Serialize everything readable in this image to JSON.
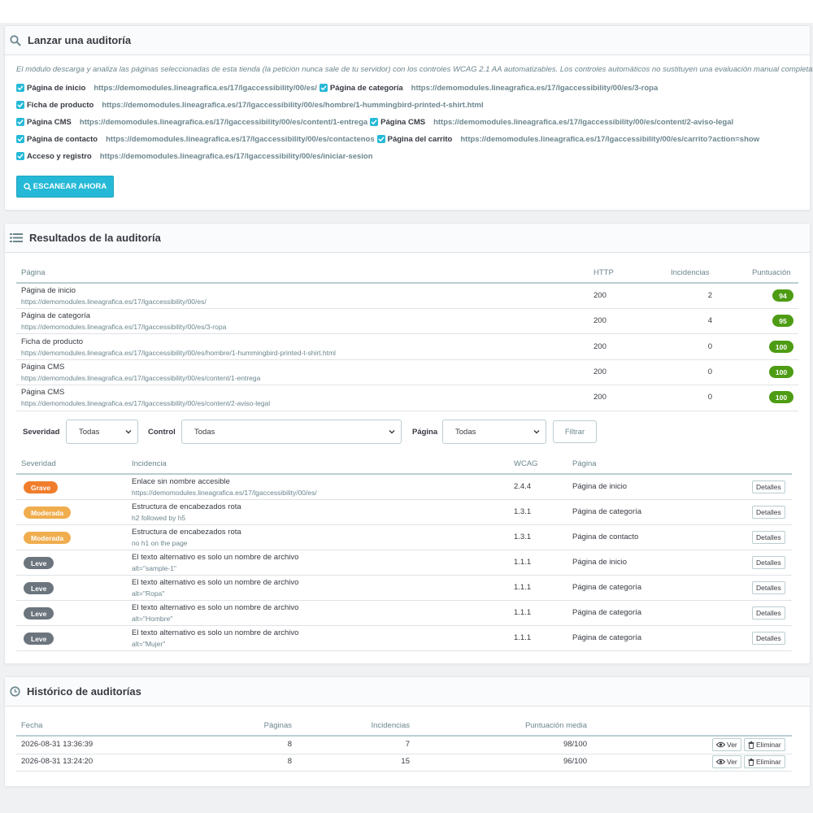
{
  "launch": {
    "title": "Lanzar una auditoría",
    "intro": "El módulo descarga y analiza las páginas seleccionadas de esta tienda (la petición nunca sale de tu servidor) con los controles WCAG 2.1 AA automatizables. Los controles automáticos no sustituyen una evaluación manual completa.",
    "pages": [
      {
        "label": "Página de inicio",
        "url": "https://demomodules.lineagrafica.es/17/lgaccessibility/00/es/",
        "checked": true
      },
      {
        "label": "Página de categoría",
        "url": "https://demomodules.lineagrafica.es/17/lgaccessibility/00/es/3-ropa",
        "checked": true
      },
      {
        "label": "Ficha de producto",
        "url": "https://demomodules.lineagrafica.es/17/lgaccessibility/00/es/hombre/1-hummingbird-printed-t-shirt.html",
        "checked": true
      },
      {
        "label": "Página CMS",
        "url": "https://demomodules.lineagrafica.es/17/lgaccessibility/00/es/content/1-entrega",
        "checked": true
      },
      {
        "label": "Página CMS",
        "url": "https://demomodules.lineagrafica.es/17/lgaccessibility/00/es/content/2-aviso-legal",
        "checked": true
      },
      {
        "label": "Página de contacto",
        "url": "https://demomodules.lineagrafica.es/17/lgaccessibility/00/es/contactenos",
        "checked": true
      },
      {
        "label": "Página del carrito",
        "url": "https://demomodules.lineagrafica.es/17/lgaccessibility/00/es/carrito?action=show",
        "checked": true
      },
      {
        "label": "Acceso y registro",
        "url": "https://demomodules.lineagrafica.es/17/lgaccessibility/00/es/iniciar-sesion",
        "checked": true
      }
    ],
    "scan_label": "ESCANEAR AHORA"
  },
  "results": {
    "title": "Resultados de la auditoría",
    "headers": {
      "page": "Página",
      "http": "HTTP",
      "issues": "Incidencias",
      "score": "Puntuación"
    },
    "rows": [
      {
        "page": "Página de inicio",
        "url": "https://demomodules.lineagrafica.es/17/lgaccessibility/00/es/",
        "http": "200",
        "issues": "2",
        "score": "94"
      },
      {
        "page": "Página de categoría",
        "url": "https://demomodules.lineagrafica.es/17/lgaccessibility/00/es/3-ropa",
        "http": "200",
        "issues": "4",
        "score": "95"
      },
      {
        "page": "Ficha de producto",
        "url": "https://demomodules.lineagrafica.es/17/lgaccessibility/00/es/hombre/1-hummingbird-printed-t-shirt.html",
        "http": "200",
        "issues": "0",
        "score": "100"
      },
      {
        "page": "Página CMS",
        "url": "https://demomodules.lineagrafica.es/17/lgaccessibility/00/es/content/1-entrega",
        "http": "200",
        "issues": "0",
        "score": "100"
      },
      {
        "page": "Página CMS",
        "url": "https://demomodules.lineagrafica.es/17/lgaccessibility/00/es/content/2-aviso-legal",
        "http": "200",
        "issues": "0",
        "score": "100"
      }
    ],
    "filters": {
      "severity_label": "Severidad",
      "severity_value": "Todas",
      "control_label": "Control",
      "control_value": "Todas",
      "page_label": "Página",
      "page_value": "Todas",
      "filter_button": "Filtrar"
    },
    "issue_headers": {
      "severity": "Severidad",
      "issue": "Incidencia",
      "wcag": "WCAG",
      "page": "Página"
    },
    "issues": [
      {
        "severity": "Grave",
        "level": "grave",
        "title": "Enlace sin nombre accesible",
        "detail": "https://demomodules.lineagrafica.es/17/lgaccessibility/00/es/",
        "wcag": "2.4.4",
        "page": "Página de inicio",
        "button": "Detalles"
      },
      {
        "severity": "Moderada",
        "level": "moderada",
        "title": "Estructura de encabezados rota",
        "detail": "h2 followed by h5",
        "wcag": "1.3.1",
        "page": "Página de categoría",
        "button": "Detalles"
      },
      {
        "severity": "Moderada",
        "level": "moderada",
        "title": "Estructura de encabezados rota",
        "detail": "no h1 on the page",
        "wcag": "1.3.1",
        "page": "Página de contacto",
        "button": "Detalles"
      },
      {
        "severity": "Leve",
        "level": "leve",
        "title": "El texto alternativo es solo un nombre de archivo",
        "detail": "alt=\"sample-1\"",
        "wcag": "1.1.1",
        "page": "Página de inicio",
        "button": "Detalles"
      },
      {
        "severity": "Leve",
        "level": "leve",
        "title": "El texto alternativo es solo un nombre de archivo",
        "detail": "alt=\"Ropa\"",
        "wcag": "1.1.1",
        "page": "Página de categoría",
        "button": "Detalles"
      },
      {
        "severity": "Leve",
        "level": "leve",
        "title": "El texto alternativo es solo un nombre de archivo",
        "detail": "alt=\"Hombre\"",
        "wcag": "1.1.1",
        "page": "Página de categoría",
        "button": "Detalles"
      },
      {
        "severity": "Leve",
        "level": "leve",
        "title": "El texto alternativo es solo un nombre de archivo",
        "detail": "alt=\"Mujer\"",
        "wcag": "1.1.1",
        "page": "Página de categoría",
        "button": "Detalles"
      }
    ]
  },
  "history": {
    "title": "Histórico de auditorías",
    "headers": {
      "date": "Fecha",
      "pages": "Páginas",
      "issues": "Incidencias",
      "avg": "Puntuación media"
    },
    "rows": [
      {
        "date": "2026-08-31 13:36:39",
        "pages": "8",
        "issues": "7",
        "avg": "98/100",
        "view": "Ver",
        "delete": "Eliminar"
      },
      {
        "date": "2026-08-31 13:24:20",
        "pages": "8",
        "issues": "15",
        "avg": "96/100",
        "view": "Ver",
        "delete": "Eliminar"
      }
    ]
  },
  "colors": {
    "accent": "#25b9d7",
    "score_green": "#4d9c13",
    "grave": "#f07d2b",
    "moderada": "#f0ad4e",
    "leve": "#6c757d"
  }
}
